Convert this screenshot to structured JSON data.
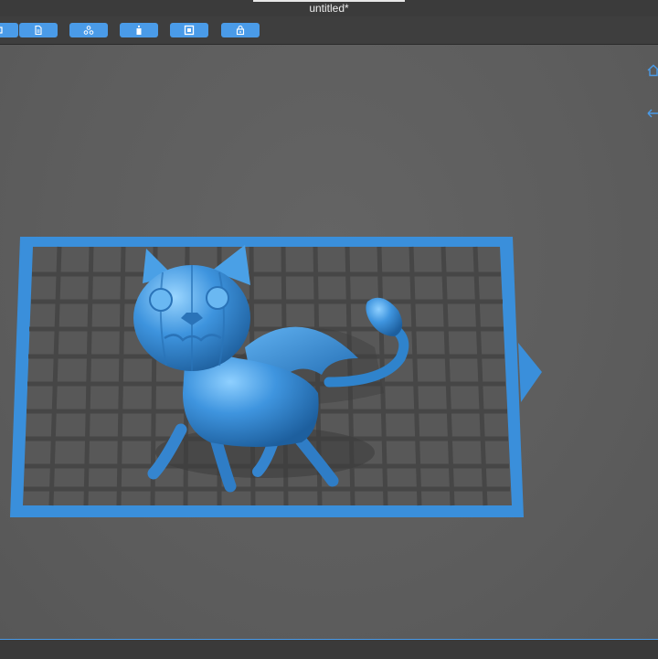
{
  "window": {
    "title": "untitled*"
  },
  "toolbar": {
    "buttons": [
      {
        "icon": "unknown-icon"
      },
      {
        "icon": "document-icon"
      },
      {
        "icon": "support-nodes-icon"
      },
      {
        "icon": "bottle-icon"
      },
      {
        "icon": "hollow-square-icon"
      },
      {
        "icon": "lock-icon"
      }
    ]
  },
  "view_controls": [
    {
      "icon": "home-view-icon"
    },
    {
      "icon": "rotate-view-icon"
    }
  ],
  "colors": {
    "accent": "#4a9be8",
    "model": "#3f95df",
    "plate": "#3a8fdb",
    "background": "#5c5c5c",
    "toolbar": "#3e3e3e"
  }
}
